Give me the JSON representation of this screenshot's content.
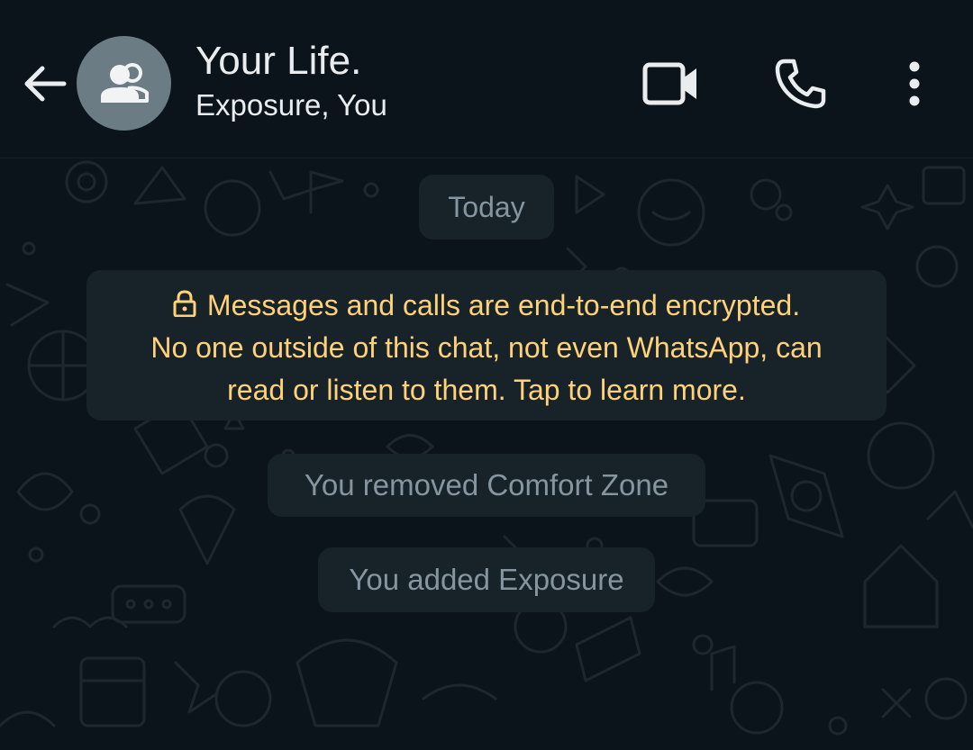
{
  "header": {
    "title": "Your Life.",
    "subtitle": "Exposure, You",
    "back_icon": "arrow-left-icon",
    "avatar_icon": "group-icon",
    "actions": [
      {
        "name": "video-call",
        "icon": "video-camera-icon"
      },
      {
        "name": "voice-call",
        "icon": "phone-icon"
      },
      {
        "name": "more-options",
        "icon": "vertical-dots-icon"
      }
    ]
  },
  "chat": {
    "date_divider": "Today",
    "encryption_notice": {
      "icon": "lock-icon",
      "line1": "Messages and calls are end-to-end encrypted.",
      "line2": "No one outside of this chat, not even WhatsApp, can",
      "line3": "read or listen to them. Tap to learn more."
    },
    "system_messages": [
      "You removed Comfort Zone",
      "You added Exposure"
    ]
  },
  "colors": {
    "background": "#0b141a",
    "bubble": "#182229",
    "notice_text": "#ffd279",
    "system_text": "#8696a0",
    "header_text": "#e9edef",
    "avatar_bg": "#6b7c85"
  }
}
